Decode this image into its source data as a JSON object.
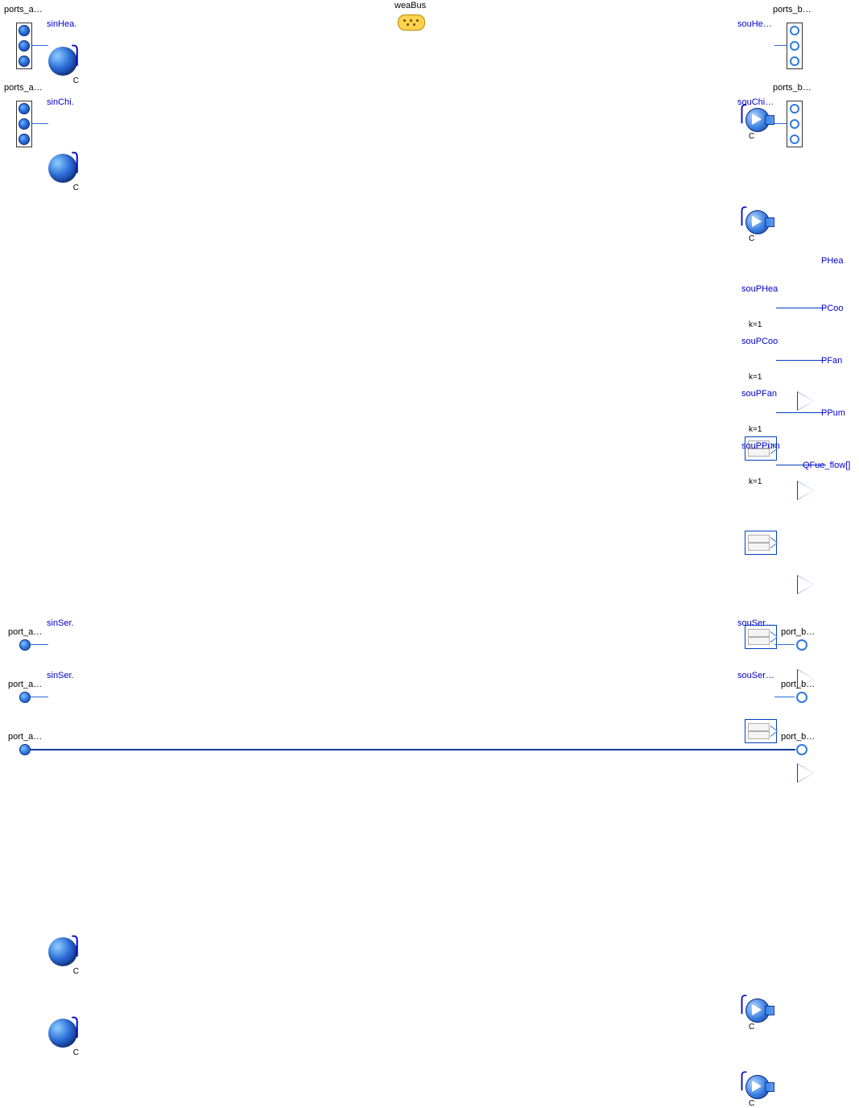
{
  "colors": {
    "accent": "#2c6dd9",
    "label_blue": "#0000cc"
  },
  "weaBus": {
    "label": "weaBus"
  },
  "ports": {
    "a_array_1": "ports_a…",
    "a_array_2": "ports_a…",
    "b_array_1": "ports_b…",
    "b_array_2": "ports_b…",
    "a_single_1": "port_a…",
    "a_single_2": "port_a…",
    "a_single_3": "port_a…",
    "b_single_1": "port_b…",
    "b_single_2": "port_b…",
    "b_single_3": "port_b…"
  },
  "left_spheres": {
    "sinHea": "sinHea.",
    "sinChi": "sinChi.",
    "sinSer1": "sinSer.",
    "sinSer2": "sinSer."
  },
  "right_pumps": {
    "souHe": "souHe…",
    "souChi": "souChi…",
    "souSer1": "souSer…",
    "souSer2": "souSer…"
  },
  "gains": [
    {
      "name": "souPHea",
      "k": "k=1",
      "out": "PHea"
    },
    {
      "name": "souPCoo",
      "k": "k=1",
      "out": "PCoo"
    },
    {
      "name": "souPFan",
      "k": "k=1",
      "out": "PFan"
    },
    {
      "name": "souPPum",
      "k": "k=1",
      "out": "PPum"
    }
  ],
  "extra_outputs": {
    "qfue": "QFue_flow[]"
  }
}
